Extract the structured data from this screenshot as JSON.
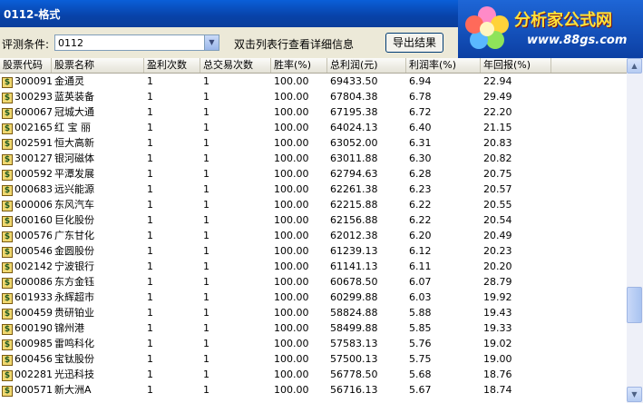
{
  "window": {
    "title": "0112-格式"
  },
  "logo": {
    "name": "分析家公式网",
    "url": "www.88gs.com"
  },
  "toolbar": {
    "condition_label": "评测条件:",
    "condition_value": "0112",
    "hint": "双击列表行查看详细信息",
    "export_label": "导出结果"
  },
  "columns": [
    "股票代码",
    "股票名称",
    "盈利次数",
    "总交易次数",
    "胜率(%)",
    "总利润(元)",
    "利润率(%)",
    "年回报(%)"
  ],
  "rows": [
    [
      "300091",
      "金通灵",
      "1",
      "1",
      "100.00",
      "69433.50",
      "6.94",
      "22.94"
    ],
    [
      "300293",
      "蓝英装备",
      "1",
      "1",
      "100.00",
      "67804.38",
      "6.78",
      "29.49"
    ],
    [
      "600067",
      "冠城大通",
      "1",
      "1",
      "100.00",
      "67195.38",
      "6.72",
      "22.20"
    ],
    [
      "002165",
      "红 宝 丽",
      "1",
      "1",
      "100.00",
      "64024.13",
      "6.40",
      "21.15"
    ],
    [
      "002591",
      "恒大高新",
      "1",
      "1",
      "100.00",
      "63052.00",
      "6.31",
      "20.83"
    ],
    [
      "300127",
      "银河磁体",
      "1",
      "1",
      "100.00",
      "63011.88",
      "6.30",
      "20.82"
    ],
    [
      "000592",
      "平潭发展",
      "1",
      "1",
      "100.00",
      "62794.63",
      "6.28",
      "20.75"
    ],
    [
      "000683",
      "远兴能源",
      "1",
      "1",
      "100.00",
      "62261.38",
      "6.23",
      "20.57"
    ],
    [
      "600006",
      "东风汽车",
      "1",
      "1",
      "100.00",
      "62215.88",
      "6.22",
      "20.55"
    ],
    [
      "600160",
      "巨化股份",
      "1",
      "1",
      "100.00",
      "62156.88",
      "6.22",
      "20.54"
    ],
    [
      "000576",
      "广东甘化",
      "1",
      "1",
      "100.00",
      "62012.38",
      "6.20",
      "20.49"
    ],
    [
      "000546",
      "金圆股份",
      "1",
      "1",
      "100.00",
      "61239.13",
      "6.12",
      "20.23"
    ],
    [
      "002142",
      "宁波银行",
      "1",
      "1",
      "100.00",
      "61141.13",
      "6.11",
      "20.20"
    ],
    [
      "600086",
      "东方金钰",
      "1",
      "1",
      "100.00",
      "60678.50",
      "6.07",
      "28.79"
    ],
    [
      "601933",
      "永辉超市",
      "1",
      "1",
      "100.00",
      "60299.88",
      "6.03",
      "19.92"
    ],
    [
      "600459",
      "贵研铂业",
      "1",
      "1",
      "100.00",
      "58824.88",
      "5.88",
      "19.43"
    ],
    [
      "600190",
      "锦州港",
      "1",
      "1",
      "100.00",
      "58499.88",
      "5.85",
      "19.33"
    ],
    [
      "600985",
      "雷鸣科化",
      "1",
      "1",
      "100.00",
      "57583.13",
      "5.76",
      "19.02"
    ],
    [
      "600456",
      "宝钛股份",
      "1",
      "1",
      "100.00",
      "57500.13",
      "5.75",
      "19.00"
    ],
    [
      "002281",
      "光迅科技",
      "1",
      "1",
      "100.00",
      "56778.50",
      "5.68",
      "18.76"
    ],
    [
      "000571",
      "新大洲A",
      "1",
      "1",
      "100.00",
      "56716.13",
      "5.67",
      "18.74"
    ]
  ]
}
